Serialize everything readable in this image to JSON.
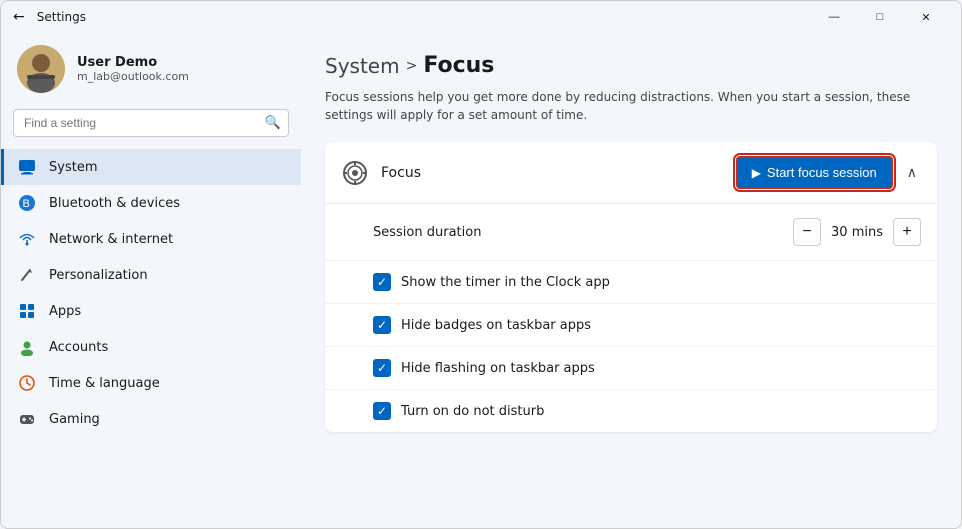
{
  "window": {
    "title": "Settings",
    "min_btn": "—",
    "max_btn": "□",
    "close_btn": "✕"
  },
  "sidebar": {
    "user": {
      "name": "User Demo",
      "email": "m_lab@outlook.com"
    },
    "search": {
      "placeholder": "Find a setting"
    },
    "nav_items": [
      {
        "id": "system",
        "label": "System",
        "active": true,
        "icon": "💻"
      },
      {
        "id": "bluetooth",
        "label": "Bluetooth & devices",
        "active": false,
        "icon": "🔵"
      },
      {
        "id": "network",
        "label": "Network & internet",
        "active": false,
        "icon": "🌐"
      },
      {
        "id": "personalization",
        "label": "Personalization",
        "active": false,
        "icon": "✏️"
      },
      {
        "id": "apps",
        "label": "Apps",
        "active": false,
        "icon": "📦"
      },
      {
        "id": "accounts",
        "label": "Accounts",
        "active": false,
        "icon": "👤"
      },
      {
        "id": "time",
        "label": "Time & language",
        "active": false,
        "icon": "🕐"
      },
      {
        "id": "gaming",
        "label": "Gaming",
        "active": false,
        "icon": "🎮"
      }
    ]
  },
  "main": {
    "breadcrumb": {
      "parent": "System",
      "separator": ">",
      "current": "Focus"
    },
    "description": "Focus sessions help you get more done by reducing distractions. When you start a session, these settings will apply for a set amount of time.",
    "panel": {
      "title": "Focus",
      "start_btn_label": "Start focus session",
      "chevron": "∧",
      "session_duration_label": "Session duration",
      "duration_value": "30",
      "duration_unit": "mins",
      "minus_label": "−",
      "plus_label": "+",
      "checkboxes": [
        {
          "id": "clock",
          "label": "Show the timer in the Clock app",
          "checked": true
        },
        {
          "id": "badges",
          "label": "Hide badges on taskbar apps",
          "checked": true
        },
        {
          "id": "flashing",
          "label": "Hide flashing on taskbar apps",
          "checked": true
        },
        {
          "id": "dnd",
          "label": "Turn on do not disturb",
          "checked": true
        }
      ]
    }
  }
}
